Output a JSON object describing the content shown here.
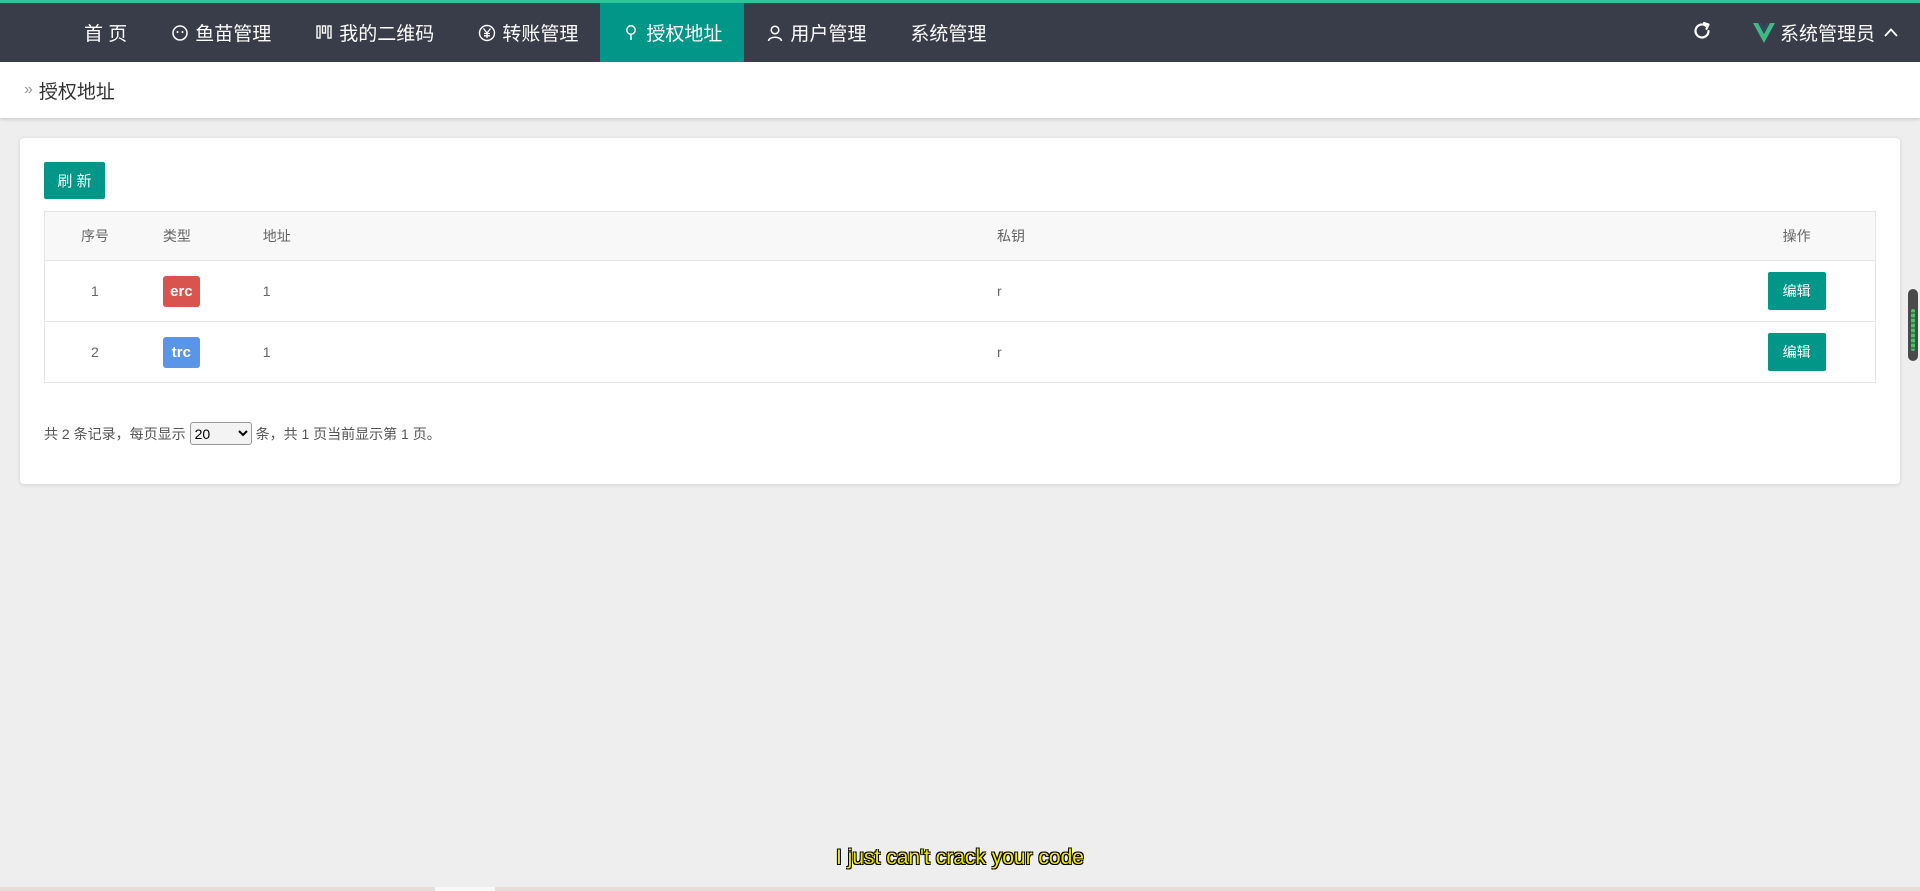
{
  "nav": {
    "items": [
      {
        "label": "首 页",
        "icon": "none"
      },
      {
        "label": "鱼苗管理",
        "icon": "smile-icon"
      },
      {
        "label": "我的二维码",
        "icon": "qrcode-icon"
      },
      {
        "label": "转账管理",
        "icon": "yen-icon"
      },
      {
        "label": "授权地址",
        "icon": "location-icon",
        "active": true
      },
      {
        "label": "用户管理",
        "icon": "user-icon"
      },
      {
        "label": "系统管理",
        "icon": "none"
      }
    ],
    "user": "系统管理员"
  },
  "breadcrumb": {
    "current": "授权地址"
  },
  "toolbar": {
    "refresh_label": "刷 新"
  },
  "table": {
    "headers": [
      "序号",
      "类型",
      "地址",
      "私钥",
      "操作"
    ],
    "rows": [
      {
        "no": "1",
        "type": "erc",
        "type_color": "#d9534f",
        "address": "1",
        "key": "r",
        "action": "编辑"
      },
      {
        "no": "2",
        "type": "trc",
        "type_color": "#5b95e8",
        "address": "1",
        "key": "r",
        "action": "编辑"
      }
    ]
  },
  "pager": {
    "before": "共 2 条记录，每页显示",
    "page_size": "20",
    "after": "条，共 1 页当前显示第 1 页。"
  },
  "subtitle": "I just can't crack your code",
  "colors": {
    "accent": "#009688",
    "topbar": "#393d49",
    "topbar_border": "#2fc59a"
  }
}
